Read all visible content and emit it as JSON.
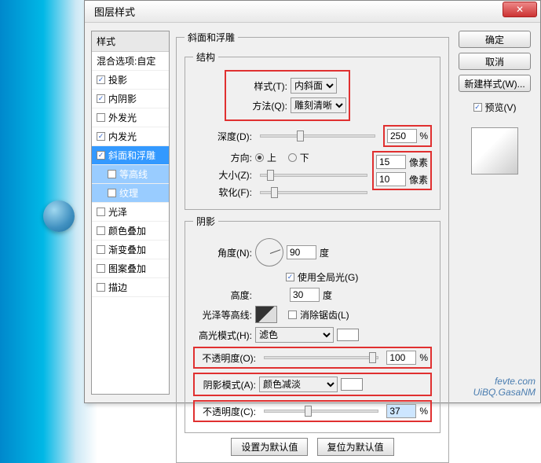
{
  "dialog": {
    "title": "图层样式"
  },
  "styles": {
    "header": "样式",
    "blend": "混合选项:自定",
    "items": [
      {
        "label": "投影",
        "checked": true
      },
      {
        "label": "内阴影",
        "checked": true
      },
      {
        "label": "外发光",
        "checked": false
      },
      {
        "label": "内发光",
        "checked": true
      },
      {
        "label": "斜面和浮雕",
        "checked": true,
        "selected": true
      },
      {
        "label": "等高线",
        "checked": false,
        "sub": true
      },
      {
        "label": "纹理",
        "checked": false,
        "sub": true
      },
      {
        "label": "光泽",
        "checked": false
      },
      {
        "label": "颜色叠加",
        "checked": false
      },
      {
        "label": "渐变叠加",
        "checked": false
      },
      {
        "label": "图案叠加",
        "checked": false
      },
      {
        "label": "描边",
        "checked": false
      }
    ]
  },
  "bevel": {
    "group": "斜面和浮雕",
    "structure": "结构",
    "style_lbl": "样式(T):",
    "style_val": "内斜面",
    "technique_lbl": "方法(Q):",
    "technique_val": "雕刻清晰",
    "depth_lbl": "深度(D):",
    "depth_val": "250",
    "depth_unit": "%",
    "direction_lbl": "方向:",
    "up": "上",
    "down": "下",
    "size_lbl": "大小(Z):",
    "size_val": "15",
    "size_unit": "像素",
    "soften_lbl": "软化(F):",
    "soften_val": "10",
    "soften_unit": "像素"
  },
  "shading": {
    "group": "阴影",
    "angle_lbl": "角度(N):",
    "angle_val": "90",
    "angle_unit": "度",
    "global": "使用全局光(G)",
    "altitude_lbl": "高度:",
    "altitude_val": "30",
    "altitude_unit": "度",
    "gloss_lbl": "光泽等高线:",
    "antialias": "消除锯齿(L)",
    "highlight_mode_lbl": "高光模式(H):",
    "highlight_mode_val": "滤色",
    "highlight_opacity_lbl": "不透明度(O):",
    "highlight_opacity_val": "100",
    "pct": "%",
    "shadow_mode_lbl": "阴影模式(A):",
    "shadow_mode_val": "颜色减淡",
    "shadow_opacity_lbl": "不透明度(C):",
    "shadow_opacity_val": "37"
  },
  "footer": {
    "default": "设置为默认值",
    "reset": "复位为默认值"
  },
  "right": {
    "ok": "确定",
    "cancel": "取消",
    "newstyle": "新建样式(W)...",
    "preview": "预览(V)"
  },
  "watermark": {
    "l1": "fevte.com",
    "l2": "UiBQ.GasaNM"
  }
}
